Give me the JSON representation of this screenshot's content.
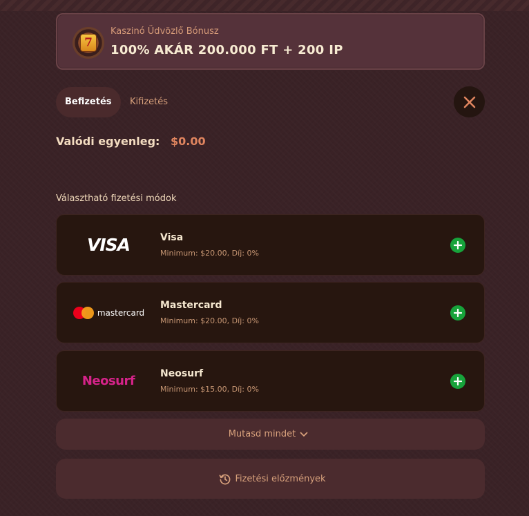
{
  "bonus": {
    "subtitle": "Kaszinó Üdvözlő Bónusz",
    "title": "100% AKÁR 200.000 FT + 200 IP",
    "icon": "slot-machine-seven-icon",
    "icon_glyph": "7"
  },
  "tabs": [
    {
      "label": "Befizetés",
      "active": true
    },
    {
      "label": "Kifizetés",
      "active": false
    }
  ],
  "balance": {
    "label": "Valódi egyenleg:",
    "amount": "$0.00"
  },
  "methods_label": "Választható fizetési módok",
  "methods": [
    {
      "name": "Visa",
      "meta": "Minimum: $20.00, Díj: 0%",
      "logo_text": "VISA"
    },
    {
      "name": "Mastercard",
      "meta": "Minimum: $20.00, Díj: 0%",
      "logo_text": "mastercard"
    },
    {
      "name": "Neosurf",
      "meta": "Minimum: $15.00, Díj: 0%",
      "logo_text": "Neosurf"
    }
  ],
  "show_all": "Mutasd mindet",
  "history": "Fizetési előzmények",
  "colors": {
    "accent": "#e0855f",
    "add_button": "#17a33b",
    "neosurf": "#d6238a",
    "mastercard_red": "#eb001b",
    "mastercard_orange": "#f79e1b"
  }
}
